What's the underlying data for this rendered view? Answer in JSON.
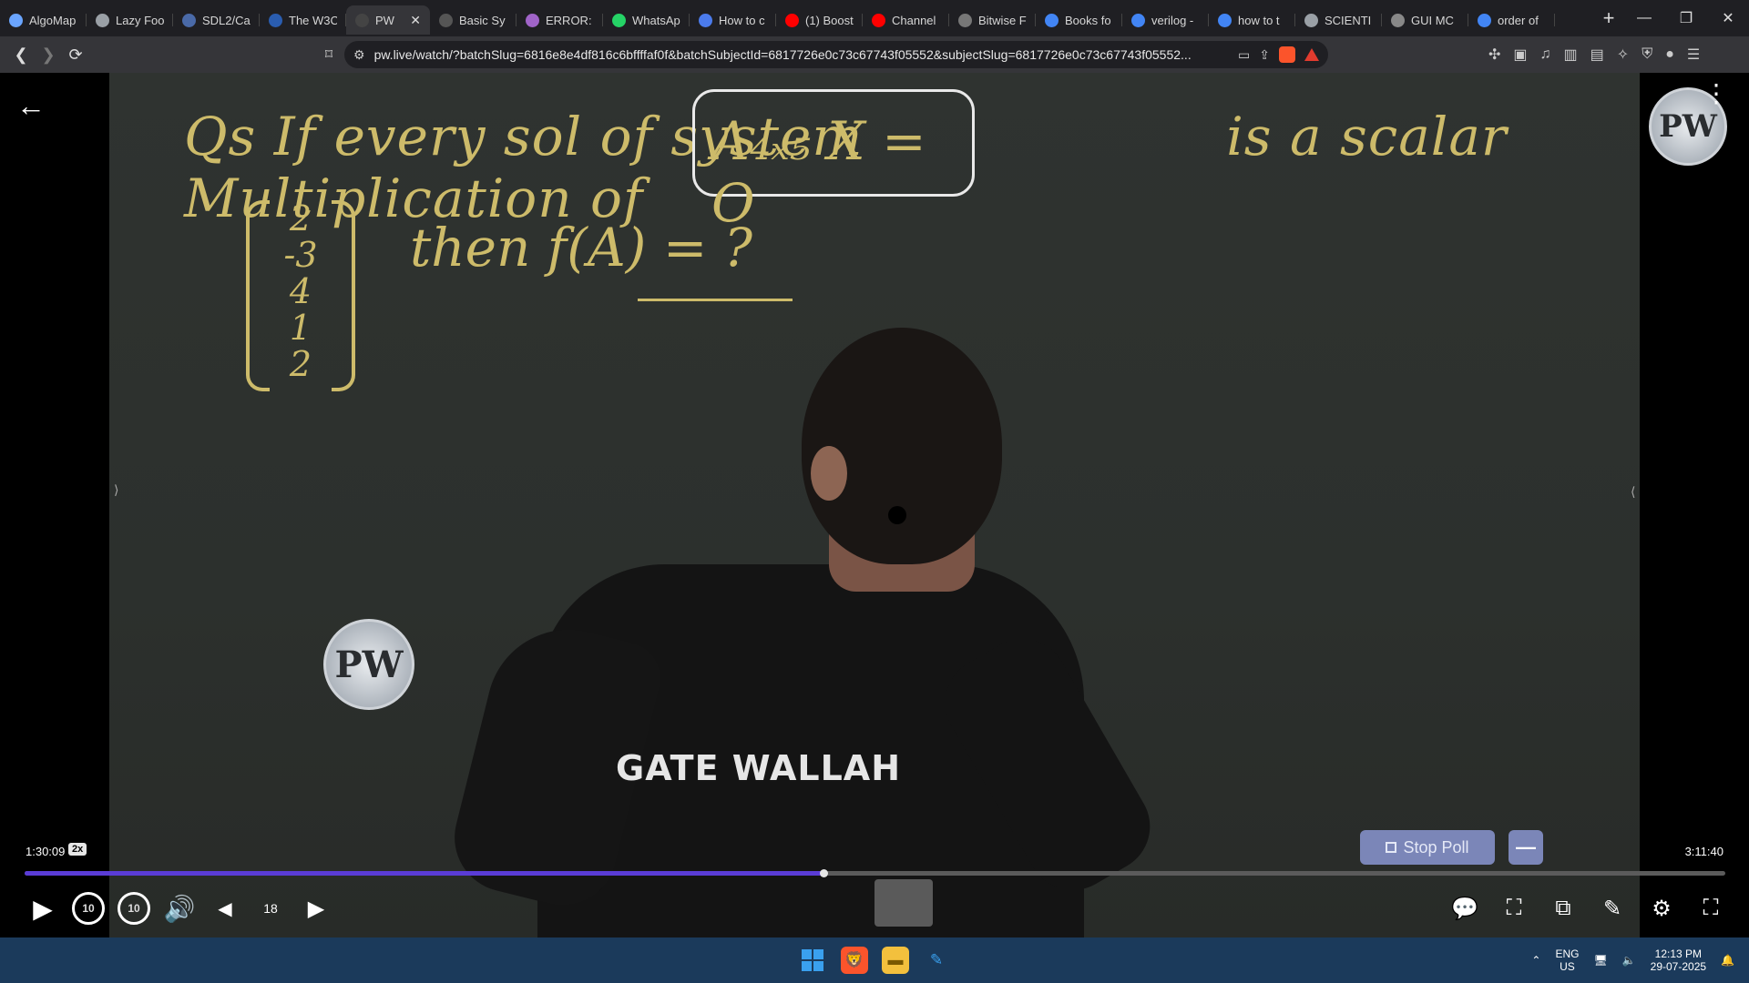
{
  "browser": {
    "tabs": [
      {
        "label": "AlgoMap",
        "icon": "algomap-icon",
        "color": "#6aa5ff"
      },
      {
        "label": "Lazy Foo",
        "icon": "web-icon",
        "color": "#9aa0a6"
      },
      {
        "label": "SDL2/Ca",
        "icon": "sdl-icon",
        "color": "#4a6aa8"
      },
      {
        "label": "The W3C",
        "icon": "w3c-icon",
        "color": "#2a5db0"
      },
      {
        "label": "PW",
        "icon": "pw-icon",
        "color": "#444"
      },
      {
        "label": "Basic Sy",
        "icon": "page-icon",
        "color": "#555"
      },
      {
        "label": "ERROR: ",
        "icon": "error-icon",
        "color": "#a064c8"
      },
      {
        "label": "WhatsAp",
        "icon": "whatsapp-icon",
        "color": "#25d366"
      },
      {
        "label": "How to c",
        "icon": "copilot-icon",
        "color": "#4b7bec"
      },
      {
        "label": "(1) Boost",
        "icon": "youtube-icon",
        "color": "#ff0000"
      },
      {
        "label": "Channel",
        "icon": "youtube-icon",
        "color": "#ff0000"
      },
      {
        "label": "Bitwise F",
        "icon": "bitwise-icon",
        "color": "#777"
      },
      {
        "label": "Books fo",
        "icon": "google-icon",
        "color": "#4285f4"
      },
      {
        "label": "verilog -",
        "icon": "google-icon",
        "color": "#4285f4"
      },
      {
        "label": "how to t",
        "icon": "google-icon",
        "color": "#4285f4"
      },
      {
        "label": "SCIENTI",
        "icon": "web-icon",
        "color": "#9aa0a6"
      },
      {
        "label": "GUI MC",
        "icon": "chatgpt-icon",
        "color": "#888"
      },
      {
        "label": "order of",
        "icon": "google-icon",
        "color": "#4285f4"
      }
    ],
    "active_tab_index": 4,
    "url": "pw.live/watch/?batchSlug=6816e8e4df816c6bffffaf0f&batchSubjectId=6817726e0c73c67743f05552&subjectSlug=6817726e0c73c67743f05552..."
  },
  "board": {
    "line1": "Qs  If every sol of system",
    "box_text": "A₄ₓ₅ X = O",
    "line1_tail": "is a scalar Multiplication of",
    "line2": "then  f(A) = ?",
    "matrix": [
      "2",
      "-3",
      "4",
      "1",
      "2"
    ],
    "logo_text": "PW",
    "shirt_text": "GATE WALLAH"
  },
  "player": {
    "current_time": "1:30:09",
    "speed": "2x",
    "total_time": "3:11:40",
    "progress_fraction": 0.47,
    "stop_poll_label": "Stop Poll",
    "skip_back_label": "10",
    "skip_fwd_label": "10",
    "dock_badge": "18"
  },
  "taskbar": {
    "lang_top": "ENG",
    "lang_bottom": "US",
    "time": "12:13 PM",
    "date": "29-07-2025"
  },
  "colors": {
    "chalk": "#cdbb6a",
    "progress": "#5a3cd6",
    "poll": "#7b86b8"
  }
}
